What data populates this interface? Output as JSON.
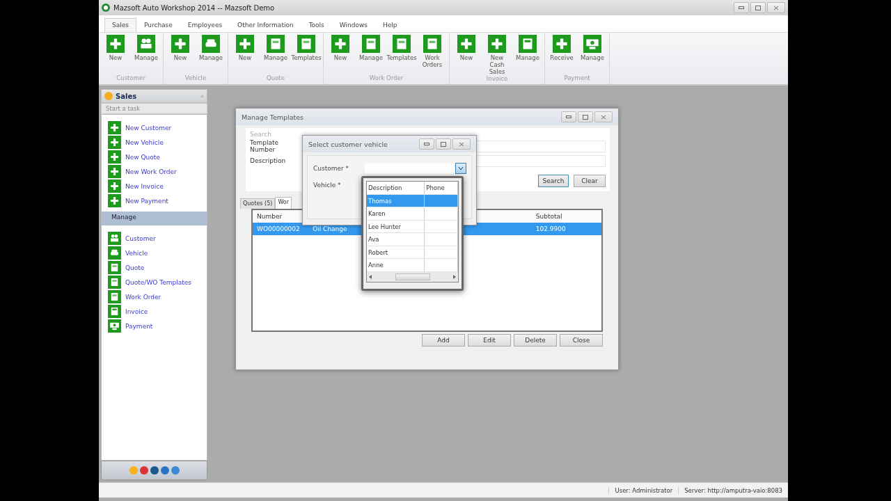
{
  "window": {
    "title": "Mazsoft Auto Workshop 2014 -- Mazsoft Demo"
  },
  "menu_tabs": [
    {
      "label": "Sales",
      "selected": true
    },
    {
      "label": "Purchase",
      "selected": false
    },
    {
      "label": "Employees",
      "selected": false
    },
    {
      "label": "Other Information",
      "selected": false
    },
    {
      "label": "Tools",
      "selected": false
    },
    {
      "label": "Windows",
      "selected": false
    },
    {
      "label": "Help",
      "selected": false
    }
  ],
  "ribbon": [
    {
      "group": "Customer",
      "buttons": [
        {
          "label": "New",
          "kind": "plus"
        },
        {
          "label": "Manage",
          "kind": "people"
        }
      ]
    },
    {
      "group": "Vehicle",
      "buttons": [
        {
          "label": "New",
          "kind": "plus"
        },
        {
          "label": "Manage",
          "kind": "car"
        }
      ]
    },
    {
      "group": "Quote",
      "buttons": [
        {
          "label": "New",
          "kind": "plus"
        },
        {
          "label": "Manage",
          "kind": "doc"
        },
        {
          "label": "Templates",
          "kind": "doc"
        }
      ]
    },
    {
      "group": "Work Order",
      "buttons": [
        {
          "label": "New",
          "kind": "plus"
        },
        {
          "label": "Manage",
          "kind": "doc"
        },
        {
          "label": "Templates",
          "kind": "doc"
        },
        {
          "label": "Work Orders",
          "kind": "doc"
        }
      ]
    },
    {
      "group": "Invoice",
      "buttons": [
        {
          "label": "New",
          "kind": "plus"
        },
        {
          "label": "New Cash Sales",
          "kind": "plus"
        },
        {
          "label": "Manage",
          "kind": "calc"
        }
      ]
    },
    {
      "group": "Payment",
      "buttons": [
        {
          "label": "Receive",
          "kind": "plus"
        },
        {
          "label": "Manage",
          "kind": "money"
        }
      ]
    }
  ],
  "sidebar": {
    "title": "Sales",
    "collapse": "«",
    "subtitle": "Start a task",
    "tasks": [
      {
        "label": "New Customer",
        "kind": "plus"
      },
      {
        "label": "New Vehicle",
        "kind": "plus"
      },
      {
        "label": "New Quote",
        "kind": "plus"
      },
      {
        "label": "New Work Order",
        "kind": "plus"
      },
      {
        "label": "New Invoice",
        "kind": "plus"
      },
      {
        "label": "New Payment",
        "kind": "plus"
      }
    ],
    "section": "Manage",
    "manage": [
      {
        "label": "Customer",
        "kind": "people"
      },
      {
        "label": "Vehicle",
        "kind": "car"
      },
      {
        "label": "Quote",
        "kind": "doc"
      },
      {
        "label": "Quote/WO Templates",
        "kind": "doc"
      },
      {
        "label": "Work Order",
        "kind": "doc"
      },
      {
        "label": "Invoice",
        "kind": "calc"
      },
      {
        "label": "Payment",
        "kind": "money"
      }
    ]
  },
  "manage_templates": {
    "title": "Manage Templates",
    "search_label": "Search",
    "fields": [
      {
        "label": "Template Number"
      },
      {
        "label": "Description"
      }
    ],
    "search_buttons": [
      "Search",
      "Clear"
    ],
    "tabs": [
      {
        "label": "Quotes (5)",
        "selected": false
      },
      {
        "label": "Wor",
        "selected": true
      }
    ],
    "columns": [
      "Number",
      "Subtotal"
    ],
    "rows": [
      {
        "number": "WO00000002",
        "column_2": "Oil Change",
        "subtotal": "102.9900",
        "selected": true
      }
    ],
    "buttons": [
      "Add",
      "Edit",
      "Delete",
      "Close"
    ]
  },
  "select_dialog": {
    "title": "Select customer vehicle",
    "fields": [
      {
        "label": "Customer *"
      },
      {
        "label": "Vehicle *"
      }
    ]
  },
  "dropdown": {
    "columns": [
      "Description",
      "Phone"
    ],
    "rows": [
      {
        "description": "Thomas",
        "selected": true
      },
      {
        "description": "Karen",
        "selected": false
      },
      {
        "description": "Lee Hunter",
        "selected": false
      },
      {
        "description": "Ava",
        "selected": false
      },
      {
        "description": "Robert",
        "selected": false
      },
      {
        "description": "Anne",
        "selected": false
      }
    ]
  },
  "status_bar": {
    "user": "User: Administrator",
    "server": "Server: http://amputra-vaio:8083"
  }
}
